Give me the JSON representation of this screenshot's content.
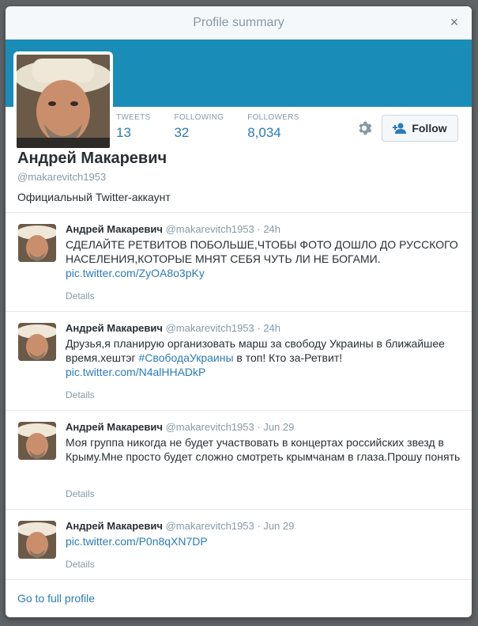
{
  "modal": {
    "title": "Profile summary",
    "close": "×"
  },
  "colors": {
    "banner": "#1a8cb8",
    "link": "#2b7bb9"
  },
  "profile": {
    "name": "Андрей Макаревич",
    "handle": "@makarevitch1953",
    "bio": "Официальный Twitter-аккаунт",
    "stats": [
      {
        "label": "TWEETS",
        "value": "13"
      },
      {
        "label": "FOLLOWING",
        "value": "32"
      },
      {
        "label": "FOLLOWERS",
        "value": "8,034"
      }
    ],
    "follow_label": "Follow",
    "settings_icon": "gear-icon"
  },
  "tweets": [
    {
      "author": "Андрей Макаревич",
      "handle": "@makarevitch1953",
      "time": "· 24h",
      "text": "СДЕЛАЙТЕ РЕТВИТОВ ПОБОЛЬШЕ,ЧТОБЫ ФОТО ДОШЛО ДО РУССКОГО НАСЕЛЕНИЯ,КОТОРЫЕ МНЯТ СЕБЯ ЧУТЬ ЛИ НЕ БОГАМИ.",
      "link": "pic.twitter.com/ZyOA8o3pKy",
      "details": "Details"
    },
    {
      "author": "Андрей Макаревич",
      "handle": "@makarevitch1953",
      "time": "· 24h",
      "text_before": "Друзья,я планирую организовать марш за свободу Украины в ближайшее время.хештэг ",
      "hashtag": "#СвободаУкраины",
      "text_after": " в топ! Кто за-Ретвит!",
      "link": "pic.twitter.com/N4alHHADkP",
      "details": "Details"
    },
    {
      "author": "Андрей Макаревич",
      "handle": "@makarevitch1953",
      "time": "· Jun 29",
      "text": "Моя группа никогда не будет участвовать в концертах российских звезд в Крыму.Мне просто будет сложно смотреть крымчанам в глаза.Прошу понять",
      "details": "Details"
    },
    {
      "author": "Андрей Макаревич",
      "handle": "@makarevitch1953",
      "time": "· Jun 29",
      "link": "pic.twitter.com/P0n8qXN7DP",
      "details": "Details"
    }
  ],
  "footer": {
    "full_profile": "Go to full profile"
  }
}
